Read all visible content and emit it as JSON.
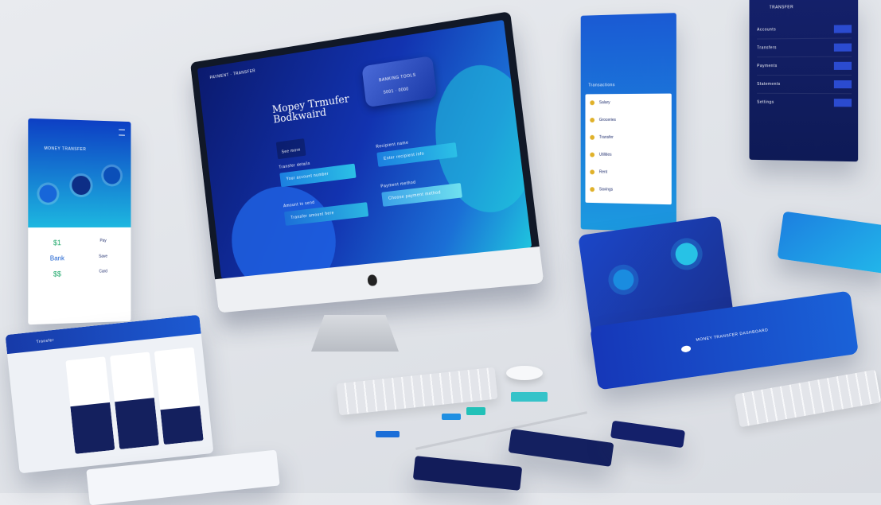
{
  "monitor": {
    "brand": "PAYMENT · TRANSFER",
    "headline_line1": "Mopey Trmufer",
    "headline_line2": "Bodkwaird",
    "card_label": "BANKING TOOLS",
    "card_number": "5001 · 0000",
    "cta_label": "See more",
    "fields": [
      {
        "label": "Transfer details",
        "value": "Your account number"
      },
      {
        "label": "Recipient name",
        "value": "Enter recipient info"
      },
      {
        "label": "Amount to send",
        "value": "Transfer amount here"
      },
      {
        "label": "Payment method",
        "value": "Choose payment method"
      }
    ]
  },
  "left_tablet": {
    "title": "MONEY TRANSFER",
    "icons": [
      "send",
      "receive",
      "history"
    ],
    "grid": [
      "$1",
      "Pay",
      "Bank",
      "Save",
      "$$",
      "Card"
    ]
  },
  "right_phone": {
    "title": "Transactions",
    "rows": [
      "Salary",
      "Groceries",
      "Transfer",
      "Utilities",
      "Rent",
      "Savings"
    ]
  },
  "top_right_panel": {
    "title": "TRANSFER",
    "rows": [
      "Accounts",
      "Transfers",
      "Payments",
      "Statements",
      "Settings"
    ]
  },
  "keyboard_label": "",
  "bottom_left_laptop": {
    "title": "Transfer"
  },
  "wide_tablet": {
    "title": "MONEY TRANSFER DASHBOARD"
  },
  "colors": {
    "deep": "#0f2a8a",
    "mid": "#1a4fd1",
    "cyan": "#21c1e6",
    "navy": "#14205e"
  }
}
